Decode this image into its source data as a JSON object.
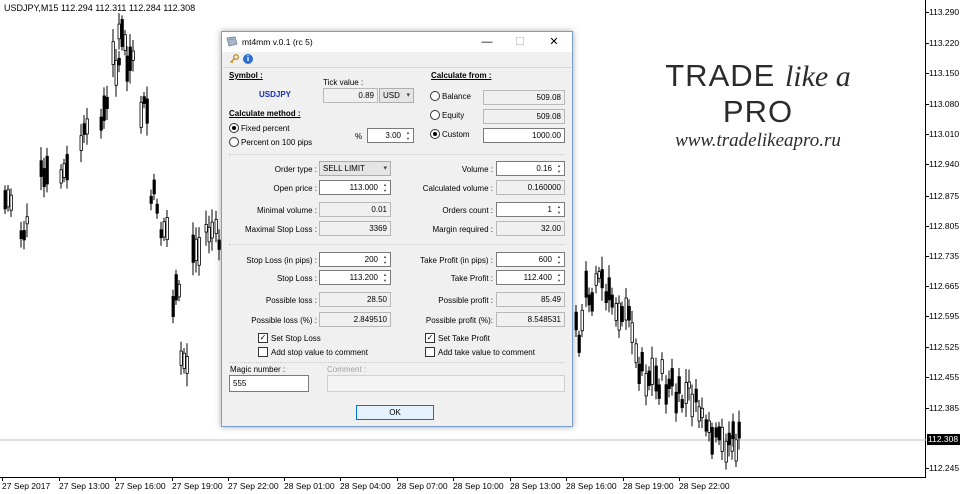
{
  "chart": {
    "title": "USDJPY,M15  112.294 112.311 112.284 112.308",
    "current_price": "112.308",
    "y_ticks": [
      "113.290",
      "113.220",
      "113.150",
      "113.080",
      "113.010",
      "112.940",
      "112.875",
      "112.805",
      "112.735",
      "112.665",
      "112.595",
      "112.525",
      "112.455",
      "112.385",
      "112.308",
      "112.245"
    ],
    "x_ticks": [
      "27 Sep 2017",
      "27 Sep 13:00",
      "27 Sep 16:00",
      "27 Sep 19:00",
      "27 Sep 22:00",
      "28 Sep 01:00",
      "28 Sep 04:00",
      "28 Sep 07:00",
      "28 Sep 10:00",
      "28 Sep 13:00",
      "28 Sep 16:00",
      "28 Sep 19:00",
      "28 Sep 22:00"
    ]
  },
  "brand": {
    "title_part1": "TRADE ",
    "title_italic": "like a ",
    "title_part2": "PRO",
    "url": "www.tradelikeapro.ru"
  },
  "dialog": {
    "title": "mt4mm v.0.1 (rc 5)",
    "minimize": "—",
    "maximize": "☐",
    "close": "✕",
    "symbol_label": "Symbol :",
    "symbol_value": "USDJPY",
    "tick_value_label": "Tick value :",
    "tick_value": "0.89",
    "tick_currency": "USD",
    "calculate_from_label": "Calculate from :",
    "balance_label": "Balance",
    "balance_value": "509.08",
    "equity_label": "Equity",
    "equity_value": "509.08",
    "custom_label": "Custom",
    "custom_value": "1000.00",
    "calc_method_label": "Calculate method :",
    "fixed_percent_label": "Fixed percent",
    "percent_100_label": "Percent on 100 pips",
    "percent_sign": "%",
    "percent_value": "3.00",
    "order_type_label": "Order type :",
    "order_type_value": "SELL LIMIT",
    "open_price_label": "Open price :",
    "open_price_value": "113.000",
    "min_volume_label": "Minimal volume :",
    "min_volume_value": "0.01",
    "max_sl_label": "Maximal Stop Loss :",
    "max_sl_value": "3369",
    "volume_label": "Volume :",
    "volume_value": "0.16",
    "calc_volume_label": "Calculated volume :",
    "calc_volume_value": "0.160000",
    "orders_count_label": "Orders count :",
    "orders_count_value": "1",
    "margin_label": "Margin required :",
    "margin_value": "32.00",
    "sl_pips_label": "Stop Loss (in pips) :",
    "sl_pips_value": "200",
    "sl_label": "Stop Loss :",
    "sl_value": "113.200",
    "possible_loss_label": "Possible loss :",
    "possible_loss_value": "28.50",
    "possible_loss_pct_label": "Possible loss (%) :",
    "possible_loss_pct_value": "2.849510",
    "set_sl_label": "Set Stop Loss",
    "add_stop_comment_label": "Add stop value to comment",
    "tp_pips_label": "Take Profit (in pips) :",
    "tp_pips_value": "600",
    "tp_label": "Take Profit :",
    "tp_value": "112.400",
    "possible_profit_label": "Possible profit :",
    "possible_profit_value": "85.49",
    "possible_profit_pct_label": "Possible profit (%):",
    "possible_profit_pct_value": "8.548531",
    "set_tp_label": "Set Take Profit",
    "add_take_comment_label": "Add take value to comment",
    "magic_label": "Magic number :",
    "magic_value": "555",
    "comment_label": "Comment :",
    "ok_label": "OK"
  }
}
